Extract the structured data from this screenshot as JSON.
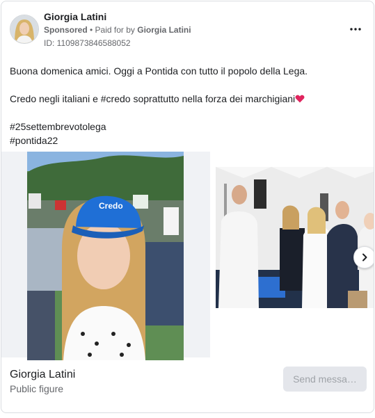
{
  "advertiser": {
    "name": "Giorgia Latini",
    "sponsored_label": "Sponsored",
    "separator": " • ",
    "paid_for_prefix": "Paid for by ",
    "paid_for_name": "Giorgia Latini",
    "ad_id": "ID: 1109873846588052"
  },
  "post": {
    "line1": "Buona domenica amici. Oggi a Pontida con tutto il popolo della Lega.",
    "line2": "Credo negli italiani e #credo soprattutto nella forza dei marchigiani",
    "hashtag1": "#25settembrevotolega",
    "hashtag2": "#pontida22"
  },
  "slide1": {
    "cap_logo_text": "Credo"
  },
  "footer": {
    "page_name": "Giorgia Latini",
    "page_category": "Public figure",
    "cta_label": "Send messa…"
  },
  "icons": {
    "more": "more-horizontal-icon",
    "next": "chevron-right-icon",
    "heart": "red-heart-emoji"
  },
  "colors": {
    "heart": "#e0245e",
    "cta_bg": "#e4e6eb",
    "cta_text": "#9fa3a8",
    "cap_blue": "#1f6fd6"
  }
}
